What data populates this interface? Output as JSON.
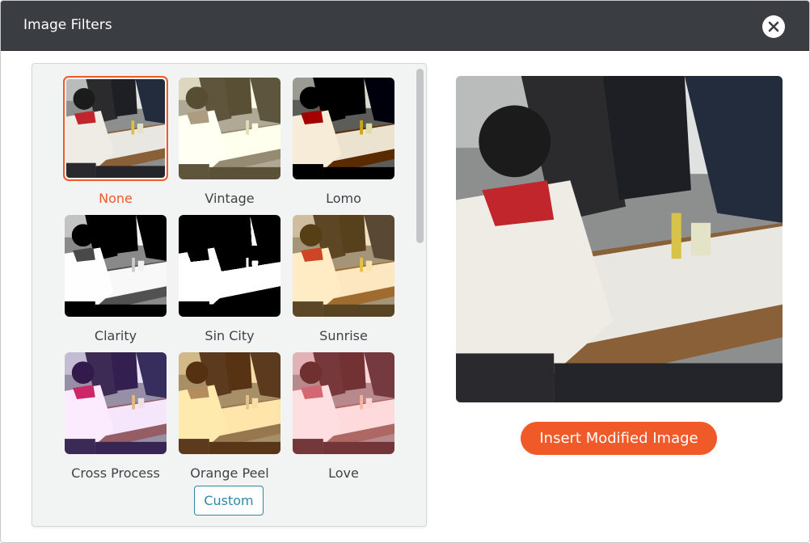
{
  "dialog": {
    "title": "Image Filters",
    "close_icon": "close-icon"
  },
  "filters": [
    {
      "label": "None",
      "selected": true
    },
    {
      "label": "Vintage",
      "selected": false
    },
    {
      "label": "Lomo",
      "selected": false
    },
    {
      "label": "Clarity",
      "selected": false
    },
    {
      "label": "Sin City",
      "selected": false
    },
    {
      "label": "Sunrise",
      "selected": false
    },
    {
      "label": "Cross Process",
      "selected": false
    },
    {
      "label": "Orange Peel",
      "selected": false
    },
    {
      "label": "Love",
      "selected": false
    }
  ],
  "custom_label": "Custom",
  "insert_label": "Insert Modified Image",
  "colors": {
    "accent": "#f05a28",
    "titlebar": "#3a3d41",
    "custom_border": "#2d8aa6"
  }
}
